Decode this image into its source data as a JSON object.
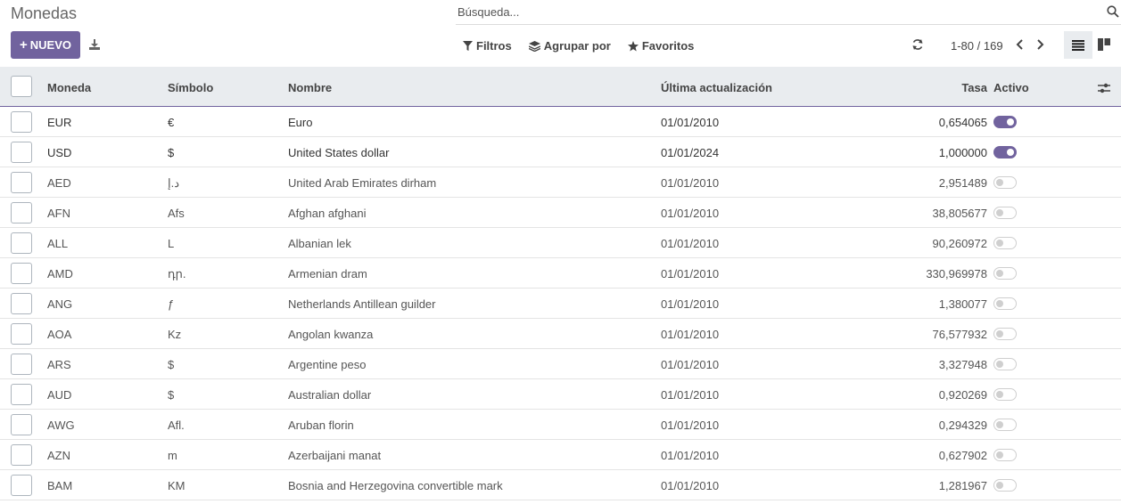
{
  "header": {
    "title": "Monedas",
    "search_placeholder": "Búsqueda...",
    "new_button_label": "NUEVO",
    "filters_label": "Filtros",
    "group_by_label": "Agrupar por",
    "favorites_label": "Favoritos",
    "pager_text": "1-80 / 169"
  },
  "table": {
    "columns": {
      "code": "Moneda",
      "symbol": "Símbolo",
      "name": "Nombre",
      "updated": "Última actualización",
      "rate": "Tasa",
      "active": "Activo"
    },
    "rows": [
      {
        "code": "EUR",
        "symbol": "€",
        "name": "Euro",
        "updated": "01/01/2010",
        "rate": "0,654065",
        "active": true
      },
      {
        "code": "USD",
        "symbol": "$",
        "name": "United States dollar",
        "updated": "01/01/2024",
        "rate": "1,000000",
        "active": true
      },
      {
        "code": "AED",
        "symbol": "د.إ",
        "name": "United Arab Emirates dirham",
        "updated": "01/01/2010",
        "rate": "2,951489",
        "active": false
      },
      {
        "code": "AFN",
        "symbol": "Afs",
        "name": "Afghan afghani",
        "updated": "01/01/2010",
        "rate": "38,805677",
        "active": false
      },
      {
        "code": "ALL",
        "symbol": "L",
        "name": "Albanian lek",
        "updated": "01/01/2010",
        "rate": "90,260972",
        "active": false
      },
      {
        "code": "AMD",
        "symbol": "դր.",
        "name": "Armenian dram",
        "updated": "01/01/2010",
        "rate": "330,969978",
        "active": false
      },
      {
        "code": "ANG",
        "symbol": "ƒ",
        "name": "Netherlands Antillean guilder",
        "updated": "01/01/2010",
        "rate": "1,380077",
        "active": false
      },
      {
        "code": "AOA",
        "symbol": "Kz",
        "name": "Angolan kwanza",
        "updated": "01/01/2010",
        "rate": "76,577932",
        "active": false
      },
      {
        "code": "ARS",
        "symbol": "$",
        "name": "Argentine peso",
        "updated": "01/01/2010",
        "rate": "3,327948",
        "active": false
      },
      {
        "code": "AUD",
        "symbol": "$",
        "name": "Australian dollar",
        "updated": "01/01/2010",
        "rate": "0,920269",
        "active": false
      },
      {
        "code": "AWG",
        "symbol": "Afl.",
        "name": "Aruban florin",
        "updated": "01/01/2010",
        "rate": "0,294329",
        "active": false
      },
      {
        "code": "AZN",
        "symbol": "m",
        "name": "Azerbaijani manat",
        "updated": "01/01/2010",
        "rate": "0,627902",
        "active": false
      },
      {
        "code": "BAM",
        "symbol": "KM",
        "name": "Bosnia and Herzegovina convertible mark",
        "updated": "01/01/2010",
        "rate": "1,281967",
        "active": false
      }
    ]
  },
  "colors": {
    "brand": "#71639e",
    "header_bg": "#e9ecef"
  }
}
